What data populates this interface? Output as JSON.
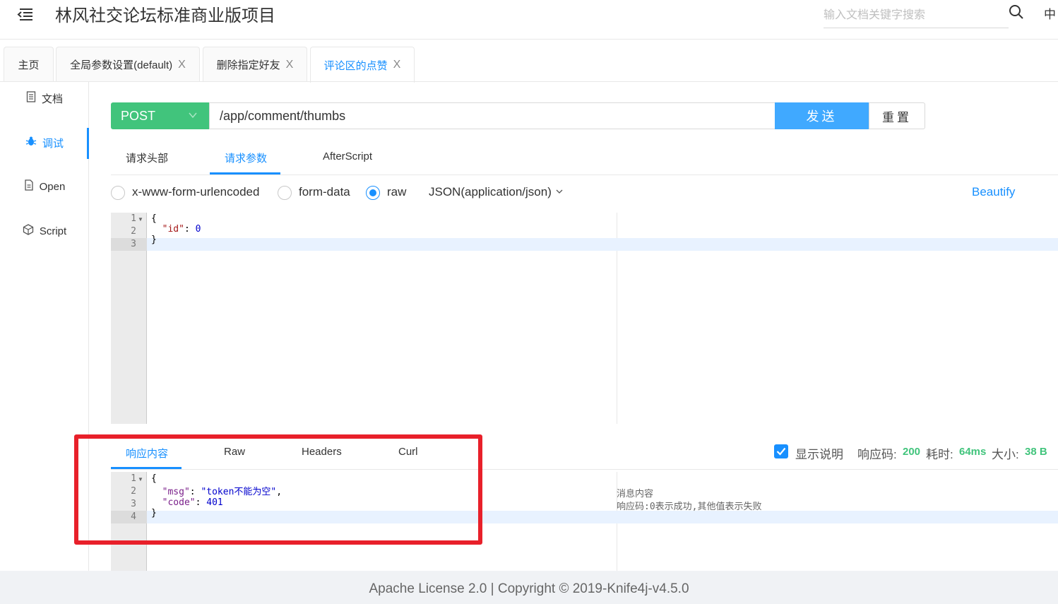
{
  "header": {
    "title": "林风社交论坛标准商业版项目",
    "search_placeholder": "输入文档关键字搜索",
    "lang": "中"
  },
  "tabs": [
    {
      "label": "主页",
      "closable": false
    },
    {
      "label": "全局参数设置(default)",
      "closable": true
    },
    {
      "label": "删除指定好友",
      "closable": true
    },
    {
      "label": "评论区的点赞",
      "closable": true,
      "active": true
    }
  ],
  "tab_close_glyph": "X",
  "sidebar": {
    "items": [
      {
        "label": "文档",
        "icon": "document-icon"
      },
      {
        "label": "调试",
        "icon": "bug-icon",
        "active": true
      },
      {
        "label": "Open",
        "icon": "file-icon"
      },
      {
        "label": "Script",
        "icon": "code-icon"
      }
    ]
  },
  "request": {
    "method": "POST",
    "url": "/app/comment/thumbs",
    "send_label": "发送",
    "reset_label": "重置",
    "tabs": [
      "请求头部",
      "请求参数",
      "AfterScript"
    ],
    "active_tab": "请求参数",
    "body_types": [
      "x-www-form-urlencoded",
      "form-data",
      "raw"
    ],
    "selected_body_type": "raw",
    "content_type": "JSON(application/json)",
    "beautify_label": "Beautify",
    "body_lines": [
      "1",
      "2",
      "3"
    ]
  },
  "response": {
    "tabs": [
      "响应内容",
      "Raw",
      "Headers",
      "Curl"
    ],
    "active_tab": "响应内容",
    "show_desc_label": "显示说明",
    "show_desc_checked": true,
    "status_label": "响应码:",
    "status_value": "200",
    "time_label": "耗时:",
    "time_value": "64ms",
    "size_label": "大小:",
    "size_value": "38 B",
    "body_lines": [
      "1",
      "2",
      "3",
      "4"
    ],
    "comments": [
      "消息内容",
      "响应码:0表示成功,其他值表示失败"
    ]
  },
  "footer": {
    "text": "Apache License 2.0 | Copyright © 2019-Knife4j-v4.5.0"
  },
  "colors": {
    "accent": "#1890ff",
    "method": "#41c47c",
    "send": "#40a9ff",
    "highlight": "#e8202a"
  }
}
